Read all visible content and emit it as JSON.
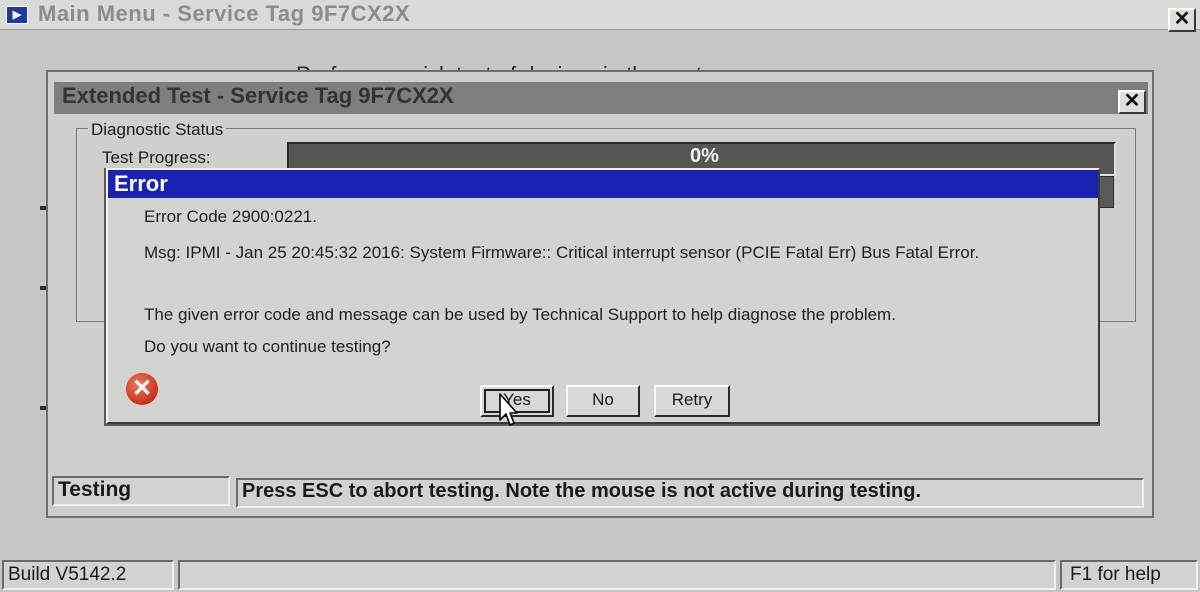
{
  "main_window": {
    "title": "Main Menu - Service Tag 9F7CX2X",
    "close_glyph": "✕",
    "background_text": "Perform a quick test of devices in the system."
  },
  "extended_test": {
    "title": "Extended Test - Service Tag 9F7CX2X",
    "close_glyph": "✕",
    "group_label": "Diagnostic Status",
    "progress_label": "Test Progress:",
    "progress_text": "0%",
    "progress_value": 0,
    "status_label": "Testing",
    "status_message": "Press ESC to abort testing.  Note the mouse is not active during testing."
  },
  "error_dialog": {
    "title": "Error",
    "code_line": "Error Code  2900:0221.",
    "msg_line": "Msg: IPMI - Jan 25 20:45:32 2016: System Firmware:: Critical interrupt sensor (PCIE Fatal Err) Bus Fatal Error.",
    "help_line": "The given error code and message can be used by Technical Support to help diagnose the problem.",
    "question": "Do you want to continue testing?",
    "icon": "error-x-icon",
    "buttons": {
      "yes": "Yes",
      "no": "No",
      "retry": "Retry"
    }
  },
  "status_bar": {
    "build": "Build  V5142.2",
    "help": "F1 for help"
  },
  "colors": {
    "error_titlebar": "#1a22b2",
    "window_bg": "#cfcfcd",
    "progress_bg": "#555554"
  }
}
